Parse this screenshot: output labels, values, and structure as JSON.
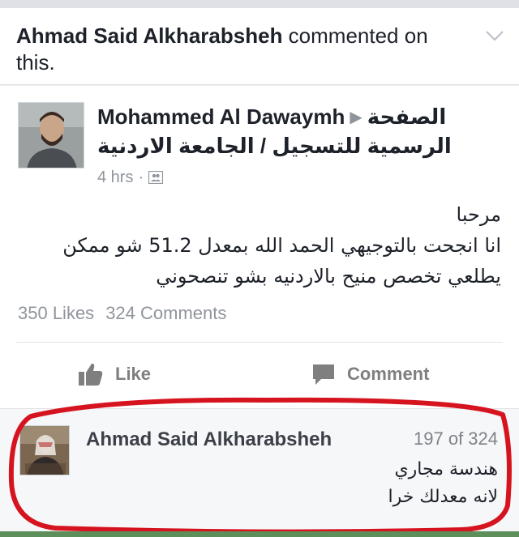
{
  "story": {
    "actor": "Ahmad Said Alkharabsheh",
    "action_text": " commented on this."
  },
  "post": {
    "author": "Mohammed Al Dawaymh",
    "page_name_line1": "الصفحة",
    "page_name_line2": "الرسمية للتسجيل / الجامعة الاردنية",
    "time": "4 hrs",
    "separator": "·",
    "body_lines": [
      "مرحبا",
      "انا انجحت بالتوجيهي الحمد الله بمعدل 51.2 شو ممكن",
      "يطلعي تخصص منيح بالاردنيه بشو تنصحوني"
    ],
    "likes": "350 Likes",
    "comments": "324 Comments"
  },
  "actions": {
    "like_label": "Like",
    "comment_label": "Comment"
  },
  "comment": {
    "author": "Ahmad Said Alkharabsheh",
    "position": "197 of 324",
    "body_lines": [
      "هندسة مجاري",
      "لانه معدلك خرا"
    ]
  },
  "colors": {
    "highlight_ring": "#d6141f",
    "muted_text": "#90949c",
    "action_icon": "#7f7f7f"
  },
  "icons": [
    "chevron-down-icon",
    "audience-friends-icon",
    "thumbs-up-icon",
    "comment-bubble-icon"
  ]
}
